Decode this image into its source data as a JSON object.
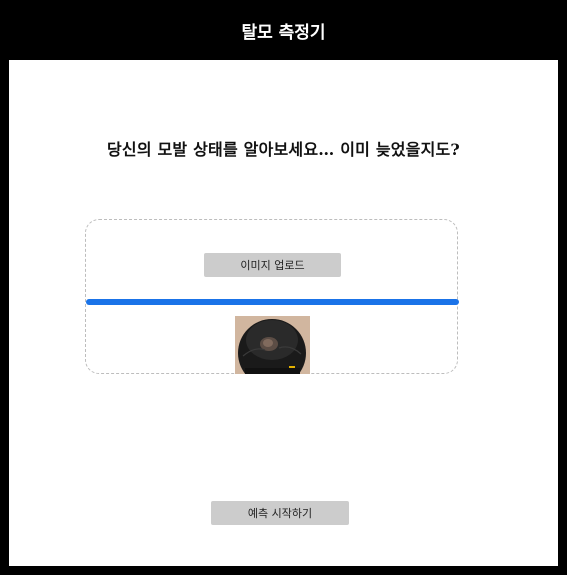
{
  "header": {
    "title": "탈모 측정기"
  },
  "main": {
    "headline": "당신의 모발 상태를 알아보세요… 이미 늦었을지도?",
    "upload": {
      "button_label": "이미지 업로드",
      "progress_percent": 100,
      "preview_icon": "uploaded-scalp-photo",
      "accent_color": "#1a73e8"
    },
    "predict_button_label": "예측 시작하기"
  }
}
